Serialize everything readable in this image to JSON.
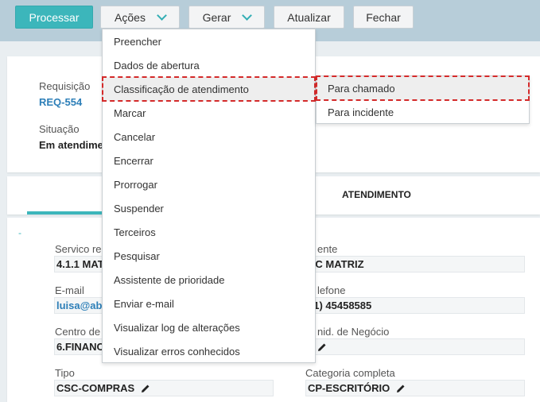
{
  "toolbar": {
    "process_label": "Processar",
    "actions_label": "Ações",
    "generate_label": "Gerar",
    "refresh_label": "Atualizar",
    "close_label": "Fechar"
  },
  "header": {
    "request_label": "Requisição",
    "request_value": "REQ-554",
    "status_label": "Situação",
    "status_value": "Em atendime"
  },
  "tabs": {
    "active_label": "ATENDIMENTO"
  },
  "form": {
    "left": [
      {
        "label": "Servico req",
        "value": "4.1.1 MAT"
      },
      {
        "label": "E-mail",
        "value": "luisa@ab"
      },
      {
        "label": "Centro de C",
        "value": "6.FINANC"
      },
      {
        "label": "Tipo",
        "value": "CSC-COMPRAS"
      }
    ],
    "right": [
      {
        "label": "ente",
        "value": "BC MATRIZ"
      },
      {
        "label": "lefone",
        "value": "51) 45458585"
      },
      {
        "label": "nid. de Negócio",
        "value": ""
      },
      {
        "label": "Categoria completa",
        "value": "CP-ESCRITÓRIO"
      }
    ],
    "dash": "-"
  },
  "actions_menu": {
    "items": [
      "Preencher",
      "Dados de abertura",
      "Classificação de atendimento",
      "Marcar",
      "Cancelar",
      "Encerrar",
      "Prorrogar",
      "Suspender",
      "Terceiros",
      "Pesquisar",
      "Assistente de prioridade",
      "Enviar e-mail",
      "Visualizar log de alterações",
      "Visualizar erros conhecidos"
    ]
  },
  "classification_submenu": {
    "items": [
      "Para chamado",
      "Para incidente"
    ]
  },
  "colors": {
    "accent": "#3cb6bb",
    "highlight_border": "#d42a2a",
    "topbar": "#b7cdd9"
  }
}
